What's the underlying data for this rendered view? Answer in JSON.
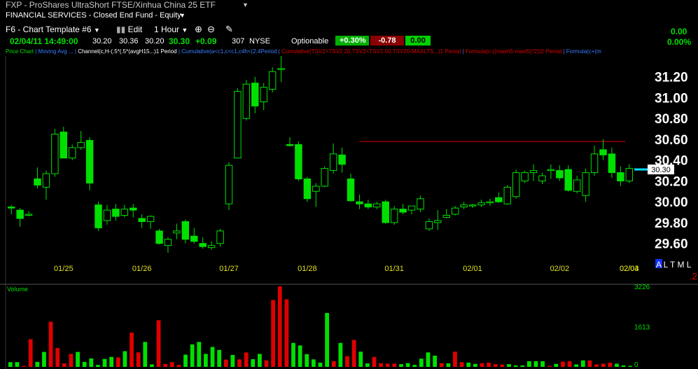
{
  "header": {
    "title": "FXP  -  ProShares UltraShort FTSE/Xinhua China 25 ETF",
    "sector": "FINANCIAL SERVICES  -  Closed End Fund  -  Equity"
  },
  "toolbar": {
    "template": "F6 - Chart Template #6",
    "edit": "Edit",
    "interval": "1 Hour"
  },
  "quote": {
    "datetime": "02/04/11 14:49:00",
    "open": "30.20",
    "high": "30.36",
    "low": "30.20",
    "last": "30.30",
    "change": "+0.09",
    "volume": "307",
    "exchange": "NYSE",
    "optionable": "Optionable",
    "pct_change": "+0.30%",
    "red_val": "-0.78",
    "green_val": "0.00",
    "right_val": "0.00",
    "right_pct": "0.00%"
  },
  "indicators": {
    "price_chart": "Price Chart",
    "line1": "Moving Avg ...",
    "line2": "Channel(c,H-(.5*(.5*(avgH15...)1 Period",
    "line3": "Cumulative(a<c1,c<c1,c4h<(2.4Period",
    "line4": "Cumulative(TSV2>TSV2.20,TSV2<TSV2.50,TSV20-MAXLTS...)1 Period",
    "line5": "Formula(c-((maxh5-maxl5)*2))2 Period",
    "line6": "Formula(c+(m"
  },
  "price_tag": "30.30",
  "alt_label": "A L T M L",
  "alt_corner": ".2",
  "colors": {
    "up": "#00e000",
    "down": "#e00000",
    "res_line": "#e00000",
    "axis_text": "#ffffff",
    "date_text": "#e0e020"
  },
  "chart_data": [
    {
      "type": "candlestick",
      "title": "",
      "ylim": [
        29.45,
        31.4
      ],
      "yticks": [
        "31.20",
        "31.00",
        "30.80",
        "30.60",
        "30.40",
        "30.20",
        "30.00",
        "29.80",
        "29.60"
      ],
      "xlabels": [
        "01/25",
        "01/26",
        "01/27",
        "01/28",
        "01/31",
        "02/01",
        "02/02",
        "02/03",
        "02/04"
      ],
      "resistance": 30.58,
      "candles": [
        {
          "o": 29.95,
          "h": 29.97,
          "l": 29.88,
          "c": 29.94,
          "up": false
        },
        {
          "o": 29.92,
          "h": 29.94,
          "l": 29.76,
          "c": 29.84,
          "up": false
        },
        {
          "o": 29.88,
          "h": 29.91,
          "l": 29.86,
          "c": 29.88,
          "up": true
        },
        {
          "o": 30.22,
          "h": 30.33,
          "l": 30.13,
          "c": 30.16,
          "up": false
        },
        {
          "o": 30.14,
          "h": 30.3,
          "l": 30.02,
          "c": 30.27,
          "up": true
        },
        {
          "o": 30.27,
          "h": 30.7,
          "l": 30.24,
          "c": 30.65,
          "up": true
        },
        {
          "o": 30.67,
          "h": 30.72,
          "l": 30.42,
          "c": 30.42,
          "up": false
        },
        {
          "o": 30.42,
          "h": 30.55,
          "l": 30.4,
          "c": 30.52,
          "up": true
        },
        {
          "o": 30.52,
          "h": 30.68,
          "l": 30.5,
          "c": 30.57,
          "up": true
        },
        {
          "o": 30.59,
          "h": 30.62,
          "l": 30.11,
          "c": 30.18,
          "up": false
        },
        {
          "o": 29.97,
          "h": 30.0,
          "l": 29.72,
          "c": 29.75,
          "up": true
        },
        {
          "o": 29.82,
          "h": 29.97,
          "l": 29.78,
          "c": 29.92,
          "up": true
        },
        {
          "o": 29.93,
          "h": 29.98,
          "l": 29.82,
          "c": 29.86,
          "up": false
        },
        {
          "o": 29.87,
          "h": 29.97,
          "l": 29.85,
          "c": 29.93,
          "up": true
        },
        {
          "o": 29.94,
          "h": 29.98,
          "l": 29.85,
          "c": 29.92,
          "up": false
        },
        {
          "o": 29.84,
          "h": 29.88,
          "l": 29.75,
          "c": 29.81,
          "up": true
        },
        {
          "o": 29.81,
          "h": 29.87,
          "l": 29.74,
          "c": 29.86,
          "up": true
        },
        {
          "o": 29.72,
          "h": 29.74,
          "l": 29.59,
          "c": 29.6,
          "up": false
        },
        {
          "o": 29.58,
          "h": 29.66,
          "l": 29.51,
          "c": 29.64,
          "up": true
        },
        {
          "o": 29.7,
          "h": 29.79,
          "l": 29.64,
          "c": 29.72,
          "up": true
        },
        {
          "o": 29.81,
          "h": 29.83,
          "l": 29.6,
          "c": 29.64,
          "up": false
        },
        {
          "o": 29.67,
          "h": 29.75,
          "l": 29.6,
          "c": 29.62,
          "up": false
        },
        {
          "o": 29.6,
          "h": 29.66,
          "l": 29.55,
          "c": 29.57,
          "up": false
        },
        {
          "o": 29.56,
          "h": 29.62,
          "l": 29.54,
          "c": 29.58,
          "up": true
        },
        {
          "o": 29.6,
          "h": 29.74,
          "l": 29.57,
          "c": 29.72,
          "up": true
        },
        {
          "o": 29.98,
          "h": 30.38,
          "l": 29.92,
          "c": 30.35,
          "up": true
        },
        {
          "o": 30.42,
          "h": 31.09,
          "l": 30.42,
          "c": 31.06,
          "up": true
        },
        {
          "o": 30.8,
          "h": 31.17,
          "l": 30.78,
          "c": 31.13,
          "up": true
        },
        {
          "o": 31.14,
          "h": 31.2,
          "l": 30.85,
          "c": 30.92,
          "up": false
        },
        {
          "o": 30.96,
          "h": 31.14,
          "l": 30.88,
          "c": 31.1,
          "up": true
        },
        {
          "o": 31.08,
          "h": 31.29,
          "l": 31.05,
          "c": 31.25,
          "up": true
        },
        {
          "o": 31.28,
          "h": 31.4,
          "l": 31.15,
          "c": 31.28,
          "up": true
        },
        {
          "o": 30.55,
          "h": 30.62,
          "l": 30.53,
          "c": 30.55,
          "up": false
        },
        {
          "o": 30.55,
          "h": 30.58,
          "l": 30.2,
          "c": 30.22,
          "up": false
        },
        {
          "o": 30.22,
          "h": 30.24,
          "l": 30.0,
          "c": 30.03,
          "up": false
        },
        {
          "o": 30.1,
          "h": 30.18,
          "l": 29.95,
          "c": 30.15,
          "up": true
        },
        {
          "o": 30.15,
          "h": 30.34,
          "l": 30.14,
          "c": 30.32,
          "up": true
        },
        {
          "o": 30.3,
          "h": 30.56,
          "l": 30.27,
          "c": 30.46,
          "up": true
        },
        {
          "o": 30.45,
          "h": 30.52,
          "l": 30.28,
          "c": 30.36,
          "up": false
        },
        {
          "o": 30.22,
          "h": 30.27,
          "l": 30.0,
          "c": 30.01,
          "up": false
        },
        {
          "o": 30.0,
          "h": 30.07,
          "l": 29.93,
          "c": 29.98,
          "up": false
        },
        {
          "o": 29.98,
          "h": 30.02,
          "l": 29.93,
          "c": 29.95,
          "up": false
        },
        {
          "o": 29.95,
          "h": 30.0,
          "l": 29.93,
          "c": 29.98,
          "up": true
        },
        {
          "o": 30.0,
          "h": 30.02,
          "l": 29.79,
          "c": 29.8,
          "up": false
        },
        {
          "o": 29.8,
          "h": 29.96,
          "l": 29.78,
          "c": 29.93,
          "up": true
        },
        {
          "o": 29.93,
          "h": 29.98,
          "l": 29.88,
          "c": 29.9,
          "up": false
        },
        {
          "o": 29.92,
          "h": 29.96,
          "l": 29.88,
          "c": 29.96,
          "up": true
        },
        {
          "o": 29.93,
          "h": 30.06,
          "l": 29.9,
          "c": 30.03,
          "up": true
        },
        {
          "o": 29.74,
          "h": 29.84,
          "l": 29.72,
          "c": 29.81,
          "up": true
        },
        {
          "o": 29.8,
          "h": 29.92,
          "l": 29.73,
          "c": 29.82,
          "up": true
        },
        {
          "o": 29.85,
          "h": 29.93,
          "l": 29.84,
          "c": 29.87,
          "up": true
        },
        {
          "o": 29.88,
          "h": 29.96,
          "l": 29.87,
          "c": 29.94,
          "up": true
        },
        {
          "o": 29.95,
          "h": 30.0,
          "l": 29.93,
          "c": 29.97,
          "up": true
        },
        {
          "o": 29.96,
          "h": 29.98,
          "l": 29.94,
          "c": 29.97,
          "up": true
        },
        {
          "o": 29.97,
          "h": 30.02,
          "l": 29.95,
          "c": 29.99,
          "up": true
        },
        {
          "o": 29.99,
          "h": 30.03,
          "l": 29.96,
          "c": 30.0,
          "up": true
        },
        {
          "o": 30.0,
          "h": 30.09,
          "l": 29.99,
          "c": 30.04,
          "up": false
        },
        {
          "o": 29.98,
          "h": 30.16,
          "l": 29.97,
          "c": 30.14,
          "up": true
        },
        {
          "o": 30.05,
          "h": 30.31,
          "l": 30.03,
          "c": 30.28,
          "up": true
        },
        {
          "o": 30.2,
          "h": 30.3,
          "l": 30.18,
          "c": 30.28,
          "up": true
        },
        {
          "o": 30.28,
          "h": 30.36,
          "l": 30.2,
          "c": 30.3,
          "up": true
        },
        {
          "o": 30.2,
          "h": 30.28,
          "l": 30.17,
          "c": 30.25,
          "up": true
        },
        {
          "o": 30.3,
          "h": 30.36,
          "l": 30.22,
          "c": 30.31,
          "up": true
        },
        {
          "o": 30.3,
          "h": 30.35,
          "l": 30.2,
          "c": 30.23,
          "up": false
        },
        {
          "o": 30.31,
          "h": 30.35,
          "l": 30.1,
          "c": 30.11,
          "up": false
        },
        {
          "o": 30.1,
          "h": 30.25,
          "l": 30.08,
          "c": 30.21,
          "up": true
        },
        {
          "o": 30.06,
          "h": 30.32,
          "l": 30.0,
          "c": 30.28,
          "up": true
        },
        {
          "o": 30.28,
          "h": 30.54,
          "l": 30.25,
          "c": 30.46,
          "up": true
        },
        {
          "o": 30.45,
          "h": 30.6,
          "l": 30.4,
          "c": 30.5,
          "up": false
        },
        {
          "o": 30.46,
          "h": 30.52,
          "l": 30.23,
          "c": 30.28,
          "up": false
        },
        {
          "o": 30.28,
          "h": 30.34,
          "l": 30.15,
          "c": 30.2,
          "up": false
        },
        {
          "o": 30.2,
          "h": 30.36,
          "l": 30.18,
          "c": 30.32,
          "up": true
        }
      ]
    },
    {
      "type": "bar",
      "title": "Volume",
      "ylim": [
        0,
        3226
      ],
      "yticks": [
        "3226",
        "1613",
        "0"
      ],
      "values": [
        190,
        190,
        40,
        1110,
        200,
        600,
        1810,
        760,
        140,
        520,
        600,
        200,
        340,
        80,
        320,
        400,
        380,
        630,
        1370,
        580,
        1000,
        100,
        1870,
        120,
        190,
        80,
        490,
        900,
        1000,
        520,
        800,
        680,
        290,
        480,
        300,
        580,
        310,
        520,
        260,
        2680,
        3550,
        2710,
        960,
        860,
        510,
        300,
        170,
        2160,
        230,
        960,
        430,
        1080,
        610,
        140,
        400,
        150,
        130,
        130,
        110,
        150,
        80,
        330,
        580,
        450,
        150,
        140,
        610,
        190,
        170,
        120,
        150,
        170,
        110,
        90,
        110,
        60,
        60,
        230,
        230,
        230,
        40,
        120,
        210,
        230,
        100,
        260,
        260,
        100,
        130,
        170,
        130,
        60,
        40
      ],
      "colors": "ggrrggrrrrggggggrgrrggrrrrggggggrgrrggrrrrggggggrgrrggrrrrggggggrgrrggrrrrggggggrgrrggrrrrggg"
    }
  ]
}
